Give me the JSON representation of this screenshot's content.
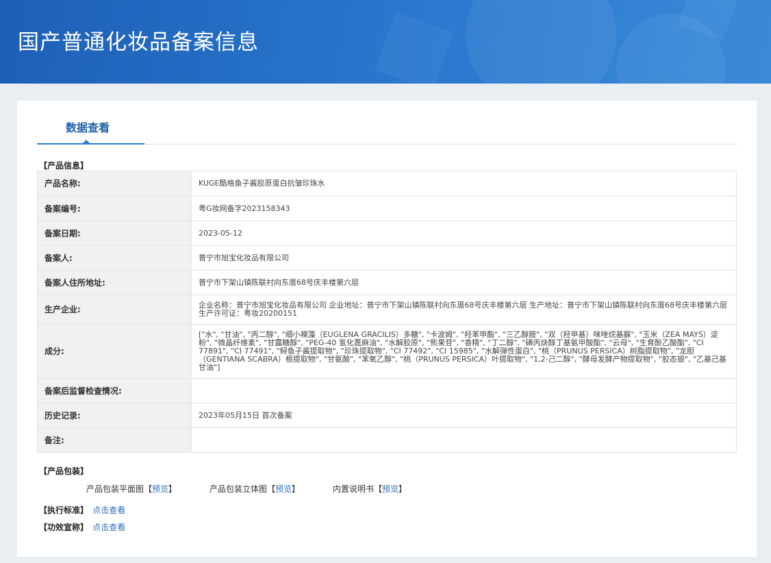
{
  "header": {
    "title": "国产普通化妆品备案信息"
  },
  "tabs": [
    {
      "label": "数据查看"
    }
  ],
  "product_info": {
    "section_label": "【产品信息】",
    "rows": [
      {
        "label": "产品名称:",
        "value": "KUGE酷格鱼子酱胶原蛋白抗皱珍珠水"
      },
      {
        "label": "备案编号:",
        "value": "粤G妆网备字2023158343"
      },
      {
        "label": "备案日期:",
        "value": "2023-05-12"
      },
      {
        "label": "备案人:",
        "value": "普宁市旭宝化妆品有限公司"
      },
      {
        "label": "备案人住所地址:",
        "value": "普宁市下架山镇陈联村向东厝68号庆丰楼第六层"
      },
      {
        "label": "生产企业:",
        "value": "企业名称：普宁市旭宝化妆品有限公司 企业地址：普宁市下架山镇陈联村向东厝68号庆丰楼第六层 生产地址：普宁市下架山镇陈联村向东厝68号庆丰楼第六层 生产许可证：粤妆20200151"
      },
      {
        "label": "成分:",
        "value": "[\"水\", \"甘油\", \"丙二醇\", \"细小裸藻（EUGLENA GRACILIS）多糖\", \"卡波姆\", \"羟苯甲酯\", \"三乙醇胺\", \"双（羟甲基）咪唑烷基脲\", \"玉米（ZEA MAYS）淀粉\", \"微晶纤维素\", \"甘露糖醇\", \"PEG-40 氢化蓖麻油\", \"水解胶原\", \"熊果苷\", \"香精\", \"丁二醇\", \"碘丙炔醇丁基氨甲酸酯\", \"云母\", \"生育酚乙酸酯\", \"CI 77891\", \"CI 77491\", \"鲟鱼子酱提取物\", \"珍珠提取物\", \"CI 77492\", \"CI 15985\", \"水解弹性蛋白\", \"桃（PRUNUS PERSICA）树脂提取物\", \"龙胆（GENTIANA SCABRA）根提取物\", \"甘氨酸\", \"苯氧乙醇\", \"桃（PRUNUS PERSICA）叶提取物\", \"1,2-己二醇\", \"酵母发酵产物提取物\", \"胶态银\", \"乙基己基甘油\"]"
      },
      {
        "label": "备案后监督检查情况:",
        "value": ""
      },
      {
        "label": "历史记录:",
        "value": "2023年05月15日 首次备案"
      },
      {
        "label": "备注:",
        "value": ""
      }
    ]
  },
  "packaging": {
    "section_label": "【产品包装】",
    "items": [
      {
        "label": "产品包装平面图",
        "bracket_open": "【",
        "link": "预览",
        "bracket_close": "】"
      },
      {
        "label": "产品包装立体图",
        "bracket_open": "【",
        "link": "预览",
        "bracket_close": "】"
      },
      {
        "label": "内置说明书",
        "bracket_open": "【",
        "link": "预览",
        "bracket_close": "】"
      }
    ]
  },
  "standard": {
    "label": "【执行标准】",
    "link": "点击查看"
  },
  "efficacy": {
    "label": "【功效宣称】",
    "link": "点击查看"
  },
  "colors": {
    "banner": "#1d5fb6",
    "accent": "#2f7bd0",
    "link": "#2c6fbf",
    "label_bg": "#f1f1f1"
  }
}
